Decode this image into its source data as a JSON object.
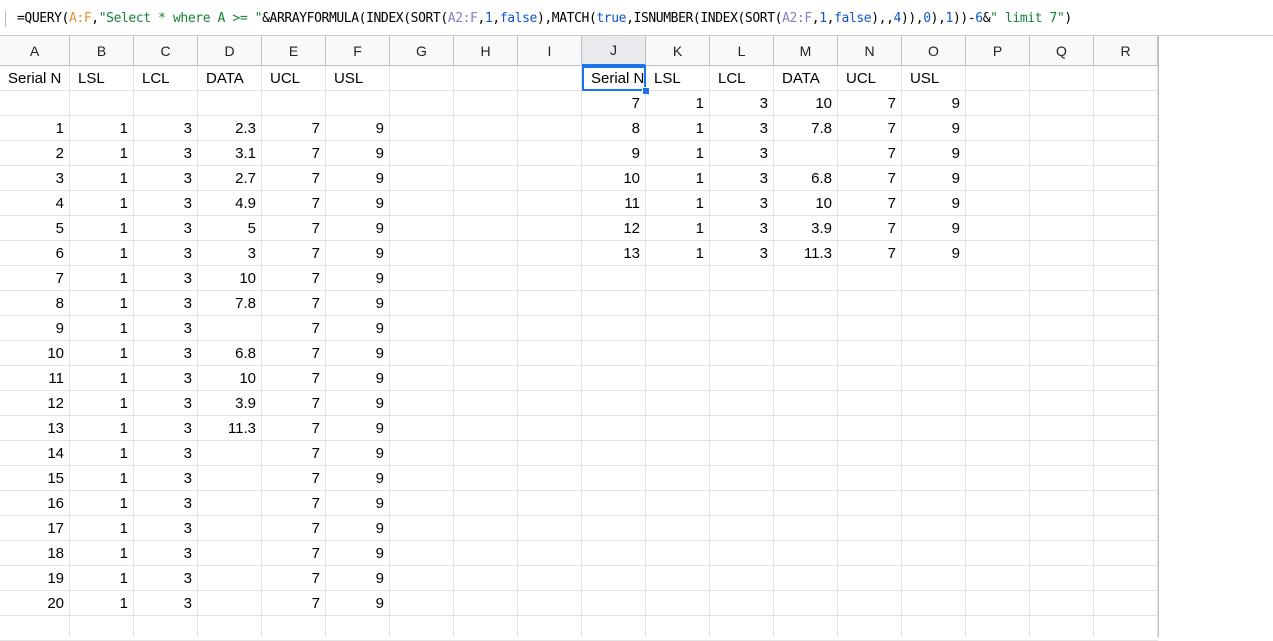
{
  "formula": [
    {
      "t": "=QUERY(",
      "c": "f-fn"
    },
    {
      "t": "A:F",
      "c": "f-ref1"
    },
    {
      "t": ",",
      "c": "f-fn"
    },
    {
      "t": "\"Select * where A >= \"",
      "c": "f-str"
    },
    {
      "t": "&ARRAYFORMULA(INDEX(SORT(",
      "c": "f-fn"
    },
    {
      "t": "A2:F",
      "c": "f-ref2"
    },
    {
      "t": ",",
      "c": "f-fn"
    },
    {
      "t": "1",
      "c": "f-num"
    },
    {
      "t": ",",
      "c": "f-fn"
    },
    {
      "t": "false",
      "c": "f-bool"
    },
    {
      "t": "),MATCH(",
      "c": "f-fn"
    },
    {
      "t": "true",
      "c": "f-bool"
    },
    {
      "t": ",ISNUMBER(INDEX(SORT(",
      "c": "f-fn"
    },
    {
      "t": "A2:F",
      "c": "f-ref2"
    },
    {
      "t": ",",
      "c": "f-fn"
    },
    {
      "t": "1",
      "c": "f-num"
    },
    {
      "t": ",",
      "c": "f-fn"
    },
    {
      "t": "false",
      "c": "f-bool"
    },
    {
      "t": "),,",
      "c": "f-fn"
    },
    {
      "t": "4",
      "c": "f-num"
    },
    {
      "t": ")),",
      "c": "f-fn"
    },
    {
      "t": "0",
      "c": "f-num"
    },
    {
      "t": "),",
      "c": "f-fn"
    },
    {
      "t": "1",
      "c": "f-num"
    },
    {
      "t": "))-",
      "c": "f-fn"
    },
    {
      "t": "6",
      "c": "f-num"
    },
    {
      "t": "&",
      "c": "f-fn"
    },
    {
      "t": "\" limit 7\"",
      "c": "f-str"
    },
    {
      "t": ")",
      "c": "f-fn"
    }
  ],
  "columns": [
    "A",
    "B",
    "C",
    "D",
    "E",
    "F",
    "G",
    "H",
    "I",
    "J",
    "K",
    "L",
    "M",
    "N",
    "O",
    "P",
    "Q",
    "R"
  ],
  "selected_column": "J",
  "left_headers": [
    "Serial N",
    "LSL",
    "LCL",
    "DATA",
    "UCL",
    "USL"
  ],
  "left_rows": [
    [
      "",
      "",
      "",
      "",
      "",
      ""
    ],
    [
      "1",
      "1",
      "3",
      "2.3",
      "7",
      "9"
    ],
    [
      "2",
      "1",
      "3",
      "3.1",
      "7",
      "9"
    ],
    [
      "3",
      "1",
      "3",
      "2.7",
      "7",
      "9"
    ],
    [
      "4",
      "1",
      "3",
      "4.9",
      "7",
      "9"
    ],
    [
      "5",
      "1",
      "3",
      "5",
      "7",
      "9"
    ],
    [
      "6",
      "1",
      "3",
      "3",
      "7",
      "9"
    ],
    [
      "7",
      "1",
      "3",
      "10",
      "7",
      "9"
    ],
    [
      "8",
      "1",
      "3",
      "7.8",
      "7",
      "9"
    ],
    [
      "9",
      "1",
      "3",
      "",
      "7",
      "9"
    ],
    [
      "10",
      "1",
      "3",
      "6.8",
      "7",
      "9"
    ],
    [
      "11",
      "1",
      "3",
      "10",
      "7",
      "9"
    ],
    [
      "12",
      "1",
      "3",
      "3.9",
      "7",
      "9"
    ],
    [
      "13",
      "1",
      "3",
      "11.3",
      "7",
      "9"
    ],
    [
      "14",
      "1",
      "3",
      "",
      "7",
      "9"
    ],
    [
      "15",
      "1",
      "3",
      "",
      "7",
      "9"
    ],
    [
      "16",
      "1",
      "3",
      "",
      "7",
      "9"
    ],
    [
      "17",
      "1",
      "3",
      "",
      "7",
      "9"
    ],
    [
      "18",
      "1",
      "3",
      "",
      "7",
      "9"
    ],
    [
      "19",
      "1",
      "3",
      "",
      "7",
      "9"
    ],
    [
      "20",
      "1",
      "3",
      "",
      "7",
      "9"
    ]
  ],
  "right_headers": [
    "Serial N",
    "LSL",
    "LCL",
    "DATA",
    "UCL",
    "USL"
  ],
  "right_rows": [
    [
      "7",
      "1",
      "3",
      "10",
      "7",
      "9"
    ],
    [
      "8",
      "1",
      "3",
      "7.8",
      "7",
      "9"
    ],
    [
      "9",
      "1",
      "3",
      "",
      "7",
      "9"
    ],
    [
      "10",
      "1",
      "3",
      "6.8",
      "7",
      "9"
    ],
    [
      "11",
      "1",
      "3",
      "10",
      "7",
      "9"
    ],
    [
      "12",
      "1",
      "3",
      "3.9",
      "7",
      "9"
    ],
    [
      "13",
      "1",
      "3",
      "11.3",
      "7",
      "9"
    ]
  ]
}
